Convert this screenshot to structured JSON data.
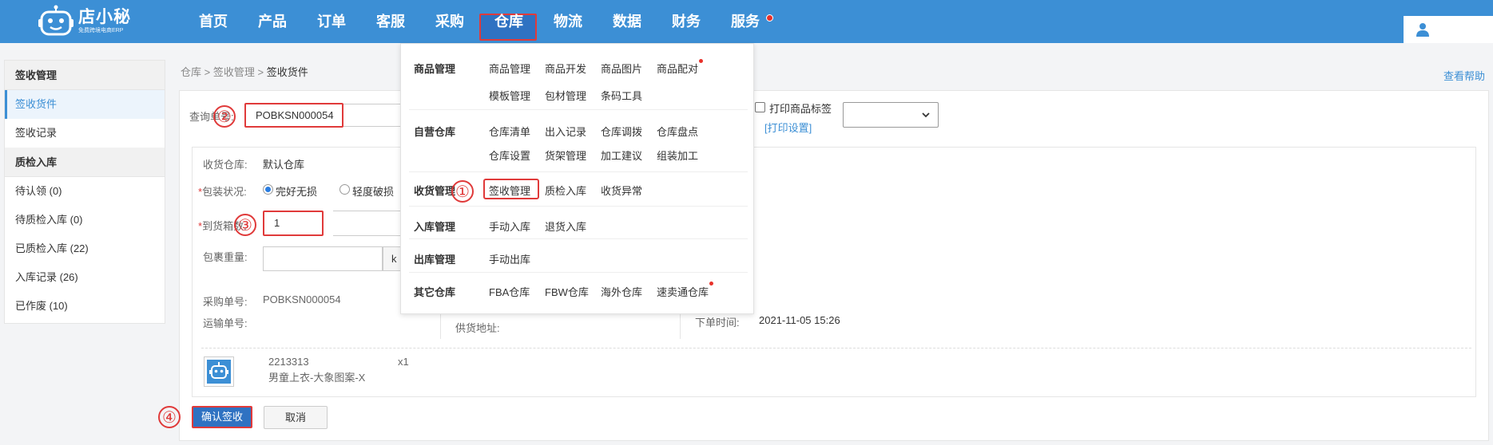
{
  "logo": {
    "name": "店小秘",
    "tagline": "免费跨境电商ERP"
  },
  "nav": {
    "items": [
      "首页",
      "产品",
      "订单",
      "客服",
      "采购",
      "仓库",
      "物流",
      "数据",
      "财务",
      "服务"
    ],
    "active": "仓库"
  },
  "sidebar": {
    "group1": "签收管理",
    "items1": [
      "签收货件",
      "签收记录"
    ],
    "group2": "质检入库",
    "items2": [
      "待认领 (0)",
      "待质检入库 (0)",
      "已质检入库 (22)",
      "入库记录 (26)",
      "已作废 (10)"
    ]
  },
  "breadcrumb": {
    "p1": "仓库",
    "p2": "签收管理",
    "current": "签收货件",
    "sep": ">"
  },
  "help": "查看帮助",
  "form": {
    "query_label": "查询单号:",
    "query_value": "POBKSN000054",
    "print_label": "打印商品标签",
    "print_settings": "打印设置",
    "warehouse_label": "收货仓库:",
    "warehouse_value": "默认仓库",
    "pack_label": "包装状况:",
    "pack_opt1": "完好无损",
    "pack_opt2": "轻度破损",
    "boxes_label": "到货箱数:",
    "boxes_value": "1",
    "weight_label": "包裹重量:",
    "weight_unit": "k",
    "required_mark": "*"
  },
  "order": {
    "po_label": "采购单号:",
    "po_value": "POBKSN000054",
    "ship_label": "运输单号:",
    "supplier_addr_label": "供货地址:",
    "order_time_label": "下单时间:",
    "order_time_value": "2021-11-05 15:26"
  },
  "item": {
    "sku": "2213313",
    "name": "男童上衣-大象图案-X",
    "qty": "x1"
  },
  "buttons": {
    "confirm": "确认签收",
    "cancel": "取消"
  },
  "steps": [
    "①",
    "②",
    "③",
    "④"
  ],
  "dropdown": {
    "sections": [
      {
        "head": "商品管理",
        "links": [
          "商品管理",
          "商品开发",
          "商品图片",
          "商品配对",
          "模板管理",
          "包材管理",
          "条码工具"
        ]
      },
      {
        "head": "自营仓库",
        "links": [
          "仓库清单",
          "出入记录",
          "仓库调拨",
          "仓库盘点",
          "仓库设置",
          "货架管理",
          "加工建议",
          "组装加工"
        ]
      },
      {
        "head": "收货管理",
        "links": [
          "签收管理",
          "质检入库",
          "收货异常"
        ]
      },
      {
        "head": "入库管理",
        "links": [
          "手动入库",
          "退货入库"
        ]
      },
      {
        "head": "出库管理",
        "links": [
          "手动出库"
        ]
      },
      {
        "head": "其它仓库",
        "links": [
          "FBA仓库",
          "FBW仓库",
          "海外仓库",
          "速卖通仓库"
        ]
      }
    ]
  },
  "colors": {
    "primary": "#3c8fd5",
    "highlight": "#e03a3a",
    "button": "#2f72c2"
  },
  "icons": [
    "robot-logo-icon",
    "user-icon",
    "chevron-down-icon",
    "product-robot-icon"
  ]
}
